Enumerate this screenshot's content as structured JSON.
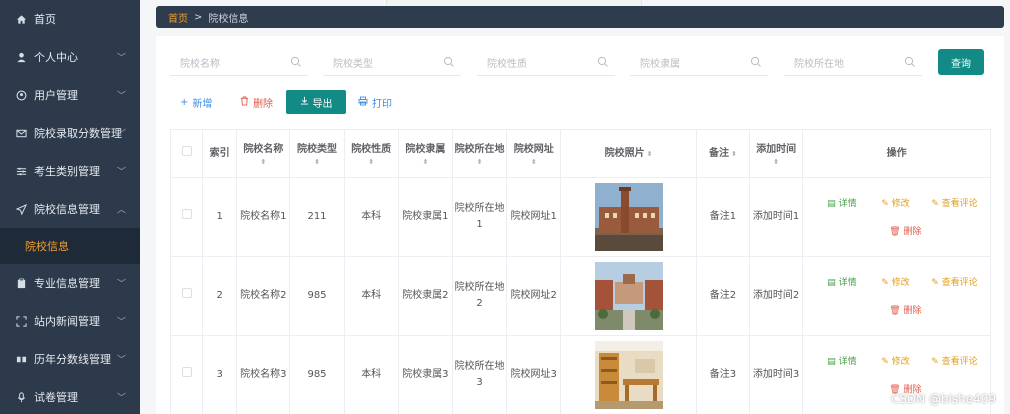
{
  "sidebar": {
    "items": [
      {
        "label": "首页",
        "icon": "home-icon",
        "chevron": false
      },
      {
        "label": "个人中心",
        "icon": "user-icon",
        "chevron": true
      },
      {
        "label": "用户管理",
        "icon": "user-circle-icon",
        "chevron": true
      },
      {
        "label": "院校录取分数管理",
        "icon": "mail-icon",
        "chevron": true
      },
      {
        "label": "考生类别管理",
        "icon": "sliders-icon",
        "chevron": true
      },
      {
        "label": "院校信息管理",
        "icon": "send-icon",
        "chevron": true,
        "expanded": true
      },
      {
        "label": "专业信息管理",
        "icon": "clipboard-icon",
        "chevron": true
      },
      {
        "label": "站内新闻管理",
        "icon": "frame-icon",
        "chevron": true
      },
      {
        "label": "历年分数线管理",
        "icon": "grid-icon",
        "chevron": true
      },
      {
        "label": "试卷管理",
        "icon": "mic-icon",
        "chevron": true
      }
    ],
    "active_sub": "院校信息"
  },
  "breadcrumb": {
    "home": "首页",
    "sep": ">",
    "current": "院校信息"
  },
  "search": {
    "fields": [
      {
        "placeholder": "院校名称"
      },
      {
        "placeholder": "院校类型"
      },
      {
        "placeholder": "院校性质"
      },
      {
        "placeholder": "院校隶属"
      },
      {
        "placeholder": "院校所在地"
      }
    ],
    "button": "查询"
  },
  "toolbar": {
    "add": "新增",
    "delete": "删除",
    "export": "导出",
    "print": "打印"
  },
  "table": {
    "headers": [
      "索引",
      "院校名称",
      "院校类型",
      "院校性质",
      "院校隶属",
      "院校所在地",
      "院校网址",
      "院校照片",
      "备注",
      "添加时间",
      "操作"
    ],
    "rows": [
      {
        "index": "1",
        "name": "院校名称1",
        "type": "211",
        "nature": "本科",
        "affil": "院校隶属1",
        "location": "院校所在地1",
        "url": "院校网址1",
        "note": "备注1",
        "time": "添加时间1"
      },
      {
        "index": "2",
        "name": "院校名称2",
        "type": "985",
        "nature": "本科",
        "affil": "院校隶属2",
        "location": "院校所在地2",
        "url": "院校网址2",
        "note": "备注2",
        "time": "添加时间2"
      },
      {
        "index": "3",
        "name": "院校名称3",
        "type": "985",
        "nature": "本科",
        "affil": "院校隶属3",
        "location": "院校所在地3",
        "url": "院校网址3",
        "note": "备注3",
        "time": "添加时间3"
      }
    ],
    "ops": {
      "detail": "详情",
      "edit": "修改",
      "comment": "查看评论",
      "delete": "删除"
    }
  },
  "watermark": "CSDN @bishe409",
  "colors": {
    "sidebar": "#2d3a4b",
    "accent": "#128b86",
    "active": "#f0a030"
  }
}
